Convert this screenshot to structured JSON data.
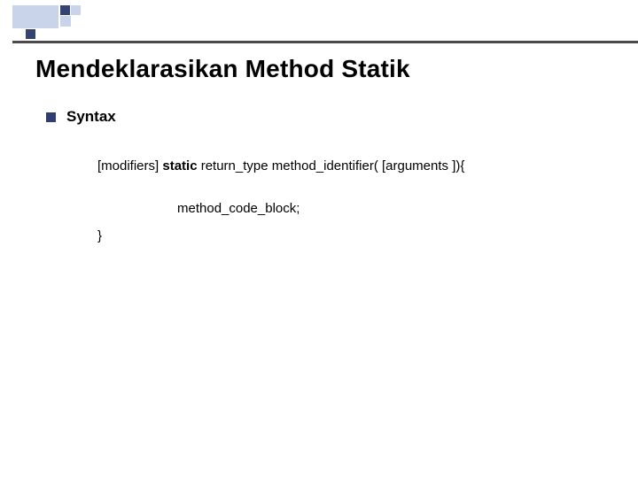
{
  "title": "Mendeklarasikan Method Statik",
  "bullet": {
    "label": "Syntax"
  },
  "code": {
    "line1_prefix": "[modifiers] ",
    "line1_keyword": "static",
    "line1_suffix": " return_type method_identifier( [arguments ]){",
    "line2": "method_code_block;",
    "line3": "}"
  }
}
